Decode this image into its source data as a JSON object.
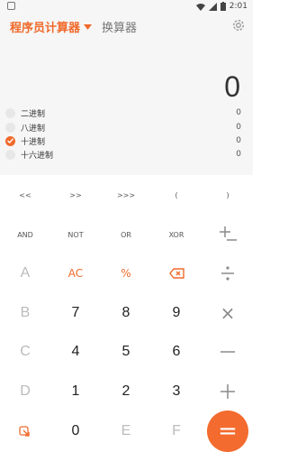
{
  "status_bar": {
    "time": "2:01"
  },
  "header": {
    "title": "程序员计算器",
    "other_tab": "换算器"
  },
  "display": {
    "value": "0"
  },
  "bases": [
    {
      "label": "二进制",
      "value": "0",
      "checked": false
    },
    {
      "label": "八进制",
      "value": "0",
      "checked": false
    },
    {
      "label": "十进制",
      "value": "0",
      "checked": true
    },
    {
      "label": "十六进制",
      "value": "0",
      "checked": false
    }
  ],
  "keys": {
    "shl": "<<",
    "shr": ">>",
    "ushr": ">>>",
    "lparen": "(",
    "rparen": ")",
    "and": "AND",
    "not": "NOT",
    "or": "OR",
    "xor": "XOR",
    "a": "A",
    "ac": "AC",
    "percent": "%",
    "b": "B",
    "seven": "7",
    "eight": "8",
    "nine": "9",
    "multiply": "×",
    "c": "C",
    "four": "4",
    "five": "5",
    "six": "6",
    "d": "D",
    "one": "1",
    "two": "2",
    "three": "3",
    "zero": "0",
    "e": "E",
    "f": "F",
    "equals": "="
  }
}
